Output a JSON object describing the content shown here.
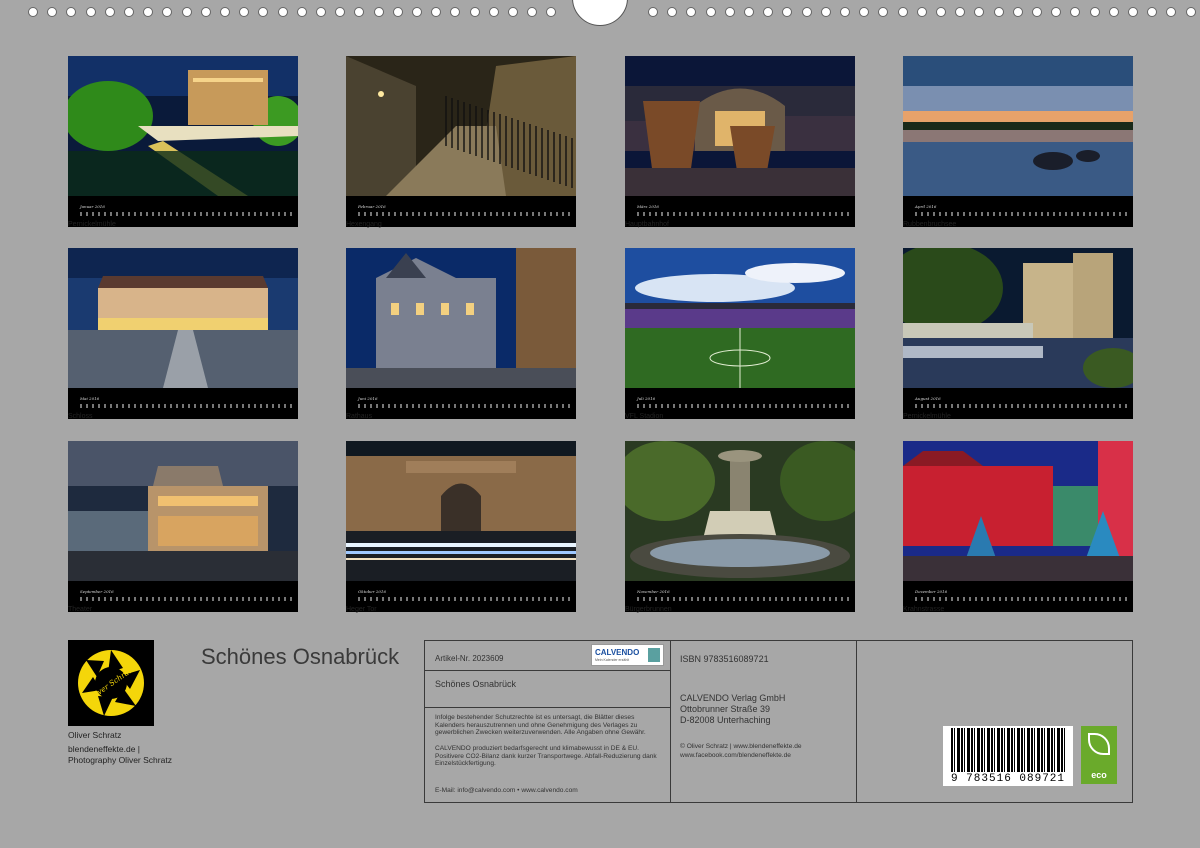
{
  "calendar": {
    "title": "Schönes Osnabrück",
    "tiles": [
      {
        "caption": "Pernickelmühle",
        "month": "Januar 2016",
        "scene": "mill-night"
      },
      {
        "caption": "Hexengang",
        "month": "Februar 2016",
        "scene": "alley-fence"
      },
      {
        "caption": "Hauptbahnhof",
        "month": "März 2016",
        "scene": "station-sculptures"
      },
      {
        "caption": "Rubbenbruchsee",
        "month": "April 2016",
        "scene": "lake-sunset"
      },
      {
        "caption": "Schloss",
        "month": "Mai 2016",
        "scene": "palace-courtyard"
      },
      {
        "caption": "Rathaus",
        "month": "Juni 2016",
        "scene": "town-hall"
      },
      {
        "caption": "VFL Stadion",
        "month": "Juli 2016",
        "scene": "stadium-pitch"
      },
      {
        "caption": "Pernickelmühle",
        "month": "August 2016",
        "scene": "mill-river"
      },
      {
        "caption": "Theater",
        "month": "September 2016",
        "scene": "theater-night"
      },
      {
        "caption": "Heger Tor",
        "month": "Oktober 2016",
        "scene": "gate-light-trails"
      },
      {
        "caption": "Bürgerbrunnen",
        "month": "November 2016",
        "scene": "fountain"
      },
      {
        "caption": "Krahnstrasse",
        "month": "Dezember 2016",
        "scene": "christmas-street"
      }
    ]
  },
  "author": {
    "logo_text": "Oliver Schratz",
    "name": "Oliver Schratz",
    "website": "blendeneffekte.de |",
    "tagline": "Photography Oliver Schratz"
  },
  "info": {
    "article": "Artikel-Nr. 2023609",
    "product_title": "Schönes Osnabrück",
    "calvendo_logo": "CALVENDO",
    "calvendo_claim": "Mein Kalender erzählt",
    "rights_text": "Infolge bestehender Schutzrechte ist es untersagt, die Blätter dieses Kalenders herauszutrennen und ohne Genehmigung des Verlages zu gewerblichen Zwecken weiterzuverwenden. Alle Angaben ohne Gewähr.",
    "eco_text": "CALVENDO produziert bedarfsgerecht und klimabewusst in DE & EU. Positivere CO2-Bilanz dank kurzer Transportwege. Abfall-Reduzierung dank Einzelstückfertigung.",
    "email_line": "E-Mail: info@calvendo.com • www.calvendo.com",
    "isbn": "ISBN 9783516089721",
    "publisher": "CALVENDO Verlag GmbH",
    "street": "Ottobrunner Straße 39",
    "city": "D-82008 Unterhaching",
    "copyright": "© Oliver Schratz | www.blendeneffekte.de",
    "facebook": "www.facebook.com/blendeneffekte.de",
    "barcode_number": "9 783516 089721",
    "eco_badge": "eco"
  },
  "colors": {
    "background": "#a7a7a7",
    "logo_yellow": "#f4d60a",
    "eco_green": "#6aaa2b"
  }
}
